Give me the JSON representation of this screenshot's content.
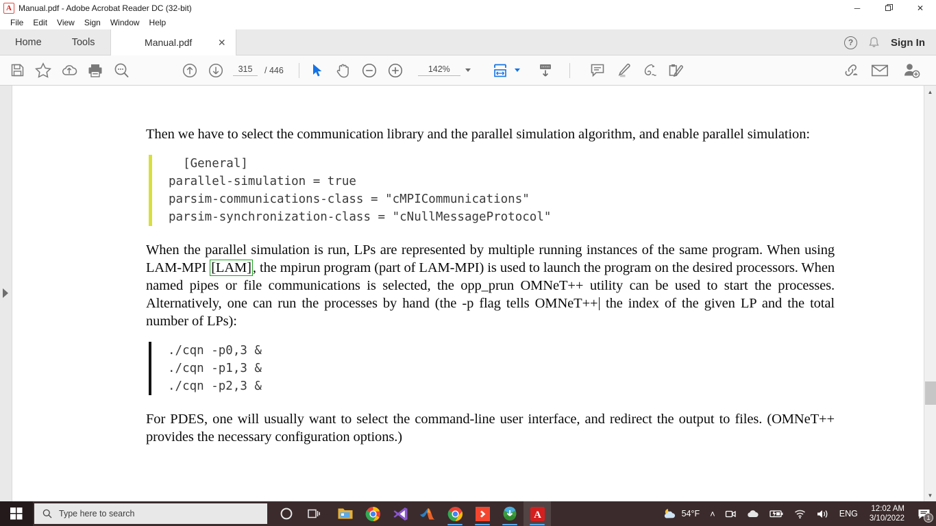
{
  "window": {
    "title": "Manual.pdf - Adobe Acrobat Reader DC (32-bit)",
    "app_icon": "acrobat-icon",
    "minimize": "─",
    "maximize": "❐",
    "close": "✕"
  },
  "menu": {
    "items": [
      {
        "label": "File"
      },
      {
        "label": "Edit"
      },
      {
        "label": "View"
      },
      {
        "label": "Sign"
      },
      {
        "label": "Window"
      },
      {
        "label": "Help"
      }
    ]
  },
  "tabs": {
    "home": "Home",
    "tools": "Tools",
    "document": "Manual.pdf",
    "close_glyph": "✕",
    "help_glyph": "?",
    "sign_in": "Sign In"
  },
  "toolbar": {
    "save_label": "save-icon",
    "star_label": "add-to-favorites-icon",
    "upload_label": "upload-to-cloud-icon",
    "print_label": "print-icon",
    "find_label": "find-text-icon",
    "prev_page_label": "previous-page-icon",
    "next_page_label": "next-page-icon",
    "page_current": "315",
    "page_total": "/ 446",
    "select_tool": "select-cursor-icon",
    "hand_tool": "hand-tool-icon",
    "zoom_out": "zoom-out-icon",
    "zoom_in": "zoom-in-icon",
    "zoom_value": "142%",
    "fit_label": "fit-page-width-icon",
    "scroll_label": "page-display-icon",
    "comment_label": "add-comment-icon",
    "highlight_label": "highlight-text-icon",
    "draw_label": "draw-freehand-icon",
    "fillsign_label": "fill-and-sign-icon",
    "share_link_label": "share-link-icon",
    "email_label": "send-email-icon",
    "adduser_label": "add-person-icon"
  },
  "document": {
    "paragraph_1": "Then we have to select the communication library and the parallel simulation algorithm, and enable parallel simulation:",
    "code_block_1": "  [General]\nparallel-simulation = true\nparsim-communications-class = \"cMPICommunications\"\nparsim-synchronization-class = \"cNullMessageProtocol\"",
    "paragraph_2a": "When the parallel simulation is run, LPs are represented by multiple running instances of the same program.  When using LAM-MPI ",
    "paragraph_2_link": "[LAM]",
    "paragraph_2b": ", the mpirun program (part of LAM-MPI) is used to launch the program on the desired processors. When named pipes or file communications is selected, the opp_prun OMNeT++ utility can be used to start the processes.  Alternatively, one can run the processes by hand (the -p flag tells OMNeT++",
    "paragraph_2c": " the index of the given LP and the total number of LPs):",
    "code_block_2": "./cqn -p0,3 &\n./cqn -p1,3 &\n./cqn -p2,3 &",
    "paragraph_3": "For PDES, one will usually want to select the command-line user interface, and redirect the output to files. (OMNeT++ provides the necessary configuration options.)"
  },
  "scrollbar": {
    "up_glyph": "▲",
    "down_glyph": "▼"
  },
  "taskbar": {
    "start_label": "windows-start-icon",
    "search_placeholder": "Type here to search",
    "cortana_label": "cortana-icon",
    "taskview_label": "task-view-icon",
    "apps": [
      {
        "name": "file-explorer-icon",
        "running": false
      },
      {
        "name": "google-chrome-icon",
        "running": false
      },
      {
        "name": "visual-studio-code-icon",
        "running": false
      },
      {
        "name": "matlab-icon",
        "running": false
      },
      {
        "name": "google-chrome-window-icon",
        "running": true
      },
      {
        "name": "everything-search-icon",
        "running": true
      },
      {
        "name": "internet-download-manager-icon",
        "running": true
      },
      {
        "name": "adobe-acrobat-reader-icon",
        "running": true
      }
    ],
    "weather_temp": "54°F",
    "tray_chevron": "˄",
    "tray_icons": [
      "camera-privacy-icon",
      "onedrive-icon",
      "battery-charging-icon",
      "wifi-icon",
      "volume-icon"
    ],
    "language": "ENG",
    "time": "12:02 AM",
    "date": "3/10/2022",
    "notification_count": "1"
  },
  "colors": {
    "accent_blue": "#1473e6",
    "link_green": "#19a119",
    "code_bar_yellow": "#d8de3c",
    "code_bar_black": "#141414",
    "taskbar_bg": "#3b2b2c"
  }
}
